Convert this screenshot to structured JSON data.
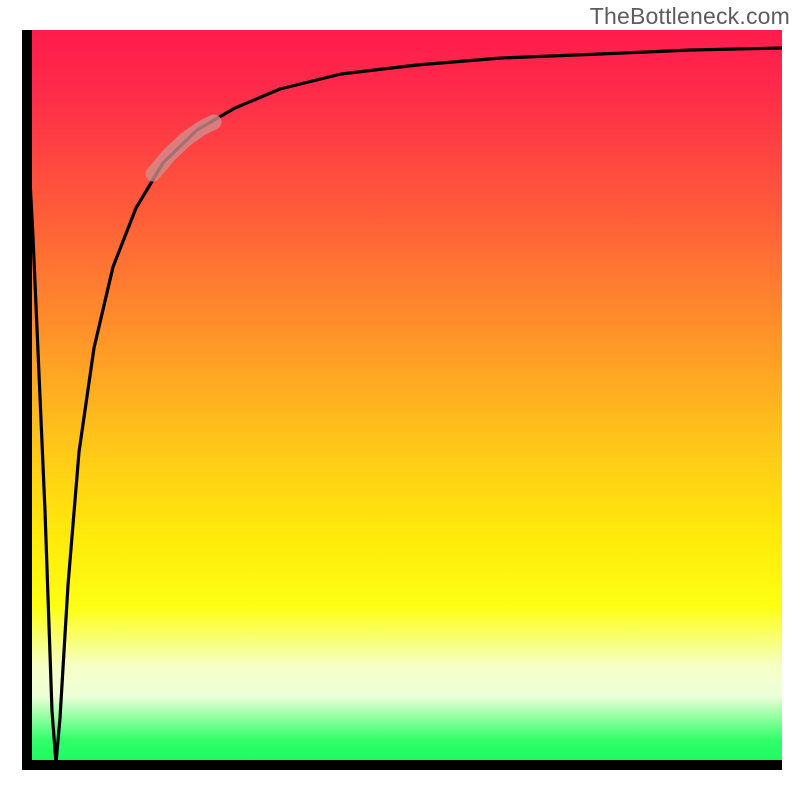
{
  "attribution": "TheBottleneck.com",
  "colors": {
    "gradient_top": "#ff1c4c",
    "gradient_mid_orange": "#ff8f2a",
    "gradient_yellow": "#fdff14",
    "gradient_green": "#18f85e",
    "curve": "#000000",
    "highlight_stroke": "#d18e8e",
    "axis": "#000000"
  },
  "chart_data": {
    "type": "line",
    "title": "",
    "xlabel": "",
    "ylabel": "",
    "xlim": [
      0,
      1
    ],
    "ylim": [
      0,
      1
    ],
    "notes": "Axes carry no tick labels; all values are normalized 0–1 based on plot-area pixel position (origin bottom-left). Lower y = greener region. Curve starts at top-left, plunges to ~0 near x≈0.045, then asymptotically rises toward y≈1.",
    "series": [
      {
        "name": "bottleneck-curve",
        "x": [
          0.0,
          0.015,
          0.03,
          0.04,
          0.045,
          0.05,
          0.06,
          0.075,
          0.095,
          0.12,
          0.15,
          0.185,
          0.23,
          0.28,
          0.34,
          0.42,
          0.52,
          0.63,
          0.76,
          0.88,
          1.0
        ],
        "y": [
          1.0,
          0.72,
          0.35,
          0.08,
          0.01,
          0.07,
          0.25,
          0.43,
          0.57,
          0.68,
          0.76,
          0.82,
          0.865,
          0.895,
          0.92,
          0.94,
          0.953,
          0.962,
          0.968,
          0.973,
          0.976
        ]
      }
    ],
    "highlight_segment": {
      "series": "bottleneck-curve",
      "x_range": [
        0.172,
        0.252
      ],
      "y_range": [
        0.806,
        0.876
      ],
      "style": "thick-translucent"
    }
  }
}
